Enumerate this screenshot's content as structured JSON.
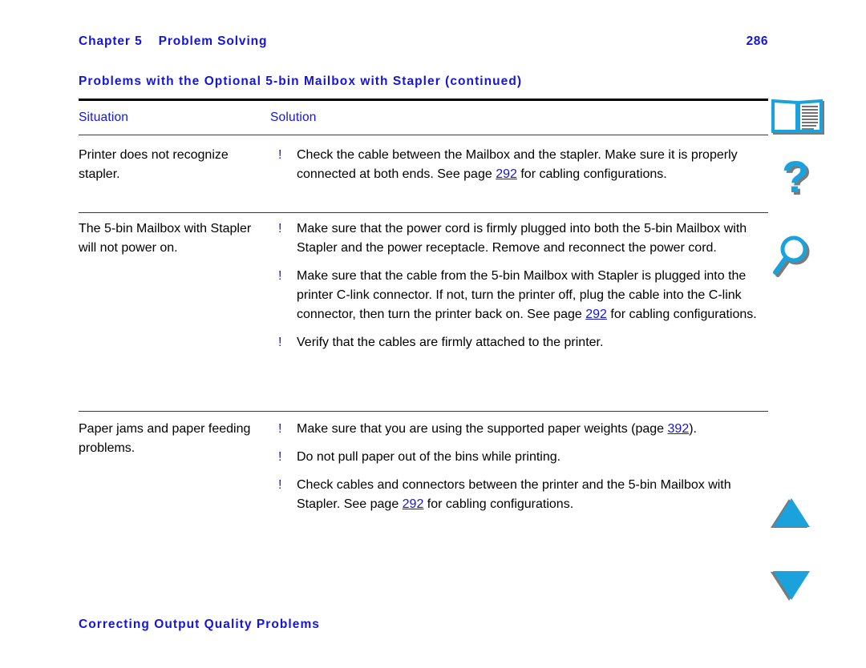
{
  "header": {
    "chapter_label": "Chapter 5",
    "chapter_title": "Problem Solving",
    "page_number": "286"
  },
  "section": {
    "title": "Problems with the Optional 5-bin Mailbox with Stapler (continued)"
  },
  "table": {
    "columns": [
      "Situation",
      "Solution"
    ],
    "rows": [
      {
        "situation": "Printer does not recognize stapler.",
        "solutions": [
          {
            "pre": "Check the cable between the Mailbox and the stapler. Make sure it is properly connected at both ends. See page ",
            "xref": "292",
            "post": " for cabling configurations."
          }
        ]
      },
      {
        "situation": "The 5-bin Mailbox with Stapler will not power on.",
        "solutions": [
          {
            "pre": "Make sure that the power cord is firmly plugged into both the 5-bin Mailbox with Stapler and the power receptacle. Remove and reconnect the power cord.",
            "xref": "",
            "post": ""
          },
          {
            "pre": "Make sure that the cable from the 5-bin Mailbox with Stapler is plugged into the printer C-link connector. If not, turn the printer off, plug the cable into the C-link connector, then turn the printer back on. See page ",
            "xref": "292",
            "post": " for cabling configurations."
          },
          {
            "pre": "Verify that the cables are firmly attached to the printer.",
            "xref": "",
            "post": ""
          }
        ]
      },
      {
        "situation": "Paper jams and paper feeding problems.",
        "solutions": [
          {
            "pre": "Make sure that you are using the supported paper weights (page ",
            "xref": "392",
            "post": ")."
          },
          {
            "pre": "Do not pull paper out of the bins while printing.",
            "xref": "",
            "post": ""
          },
          {
            "pre": "Check cables and connectors between the printer and the 5-bin Mailbox with Stapler. See page ",
            "xref": "292",
            "post": " for cabling configurations."
          }
        ]
      }
    ],
    "bullet_mark": "!"
  },
  "footer": {
    "heading": "Correcting Output Quality Problems"
  },
  "nav_rail": {
    "icons": [
      {
        "name": "book-icon",
        "label": "Table of Contents"
      },
      {
        "name": "question-mark-icon",
        "label": "Help / Index"
      },
      {
        "name": "magnifier-icon",
        "label": "Search"
      },
      {
        "name": "triangle-up-icon",
        "label": "Previous Page"
      },
      {
        "name": "triangle-down-icon",
        "label": "Next Page"
      }
    ]
  },
  "colors": {
    "link_blue": "#1414e0",
    "icon_cyan": "#1ba2dd",
    "icon_shadow": "#7a7a7a",
    "rule_black": "#000000"
  }
}
